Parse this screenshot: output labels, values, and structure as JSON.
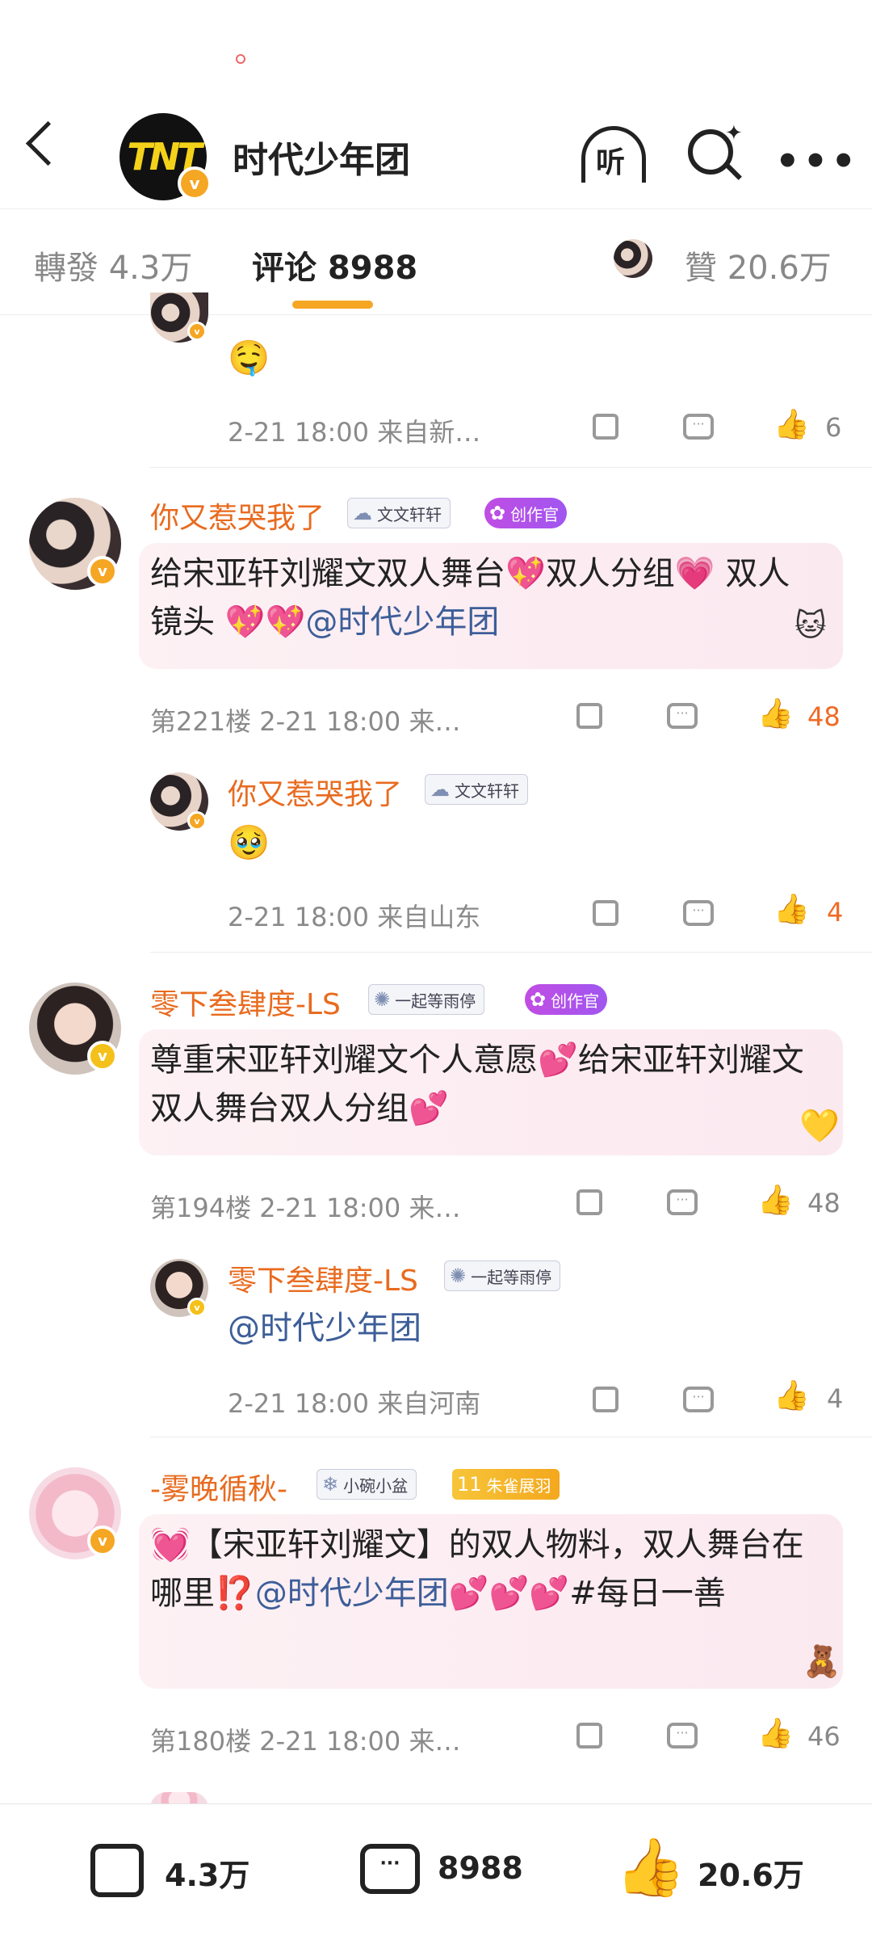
{
  "header": {
    "title": "时代少年团",
    "logo_text": "TNT",
    "verified_mark": "v",
    "listen_label": "听",
    "more_label": "•••"
  },
  "tabs": {
    "repost": "轉發 4.3万",
    "comment": "评论 8988",
    "like": "贊 20.6万"
  },
  "comments": [
    {
      "type": "partial",
      "emoji": "🤤",
      "meta": "2-21 18:00  来自新…",
      "likes": "6"
    },
    {
      "name": "你又惹哭我了",
      "badges": [
        "文文轩轩",
        "创作官"
      ],
      "text_parts": [
        "给宋亚轩刘耀文双人舞台💖双人分组💗 双人镜头 💖💖",
        "@时代少年团"
      ],
      "meta": "第221楼  2-21 18:00  来…",
      "likes": "48",
      "liked": true
    },
    {
      "name": "你又惹哭我了",
      "badges": [
        "文文轩轩"
      ],
      "emoji": "🥹",
      "meta": "2-21 18:00  来自山东",
      "likes": "4",
      "liked": true
    },
    {
      "name": "零下叁肆度-LS",
      "badges": [
        "一起等雨停",
        "创作官"
      ],
      "text": "尊重宋亚轩刘耀文个人意愿💕给宋亚轩刘耀文双人舞台双人分组💕",
      "meta": "第194楼  2-21 18:00  来…",
      "likes": "48"
    },
    {
      "name": "零下叁肆度-LS",
      "badges": [
        "一起等雨停"
      ],
      "mention": "@时代少年团",
      "meta": "2-21 18:00  来自河南",
      "likes": "4"
    },
    {
      "name": "-雾晚循秋-",
      "badges": [
        "小碗小盆",
        "朱雀展羽"
      ],
      "badge_level": "11",
      "text_parts": [
        "💓【宋亚轩刘耀文】的双人物料，双人舞台在哪里⁉️",
        "@时代少年团",
        "💕💕💕#每日一善"
      ],
      "meta": "第180楼  2-21 18:00  来…",
      "likes": "46"
    }
  ],
  "bottom": {
    "repost": "4.3万",
    "comment": "8988",
    "like": "20.6万"
  },
  "colors": {
    "accent": "#f5a623",
    "name": "#e86b1f",
    "mention": "#3d5e99",
    "like_active": "#f06a24"
  }
}
